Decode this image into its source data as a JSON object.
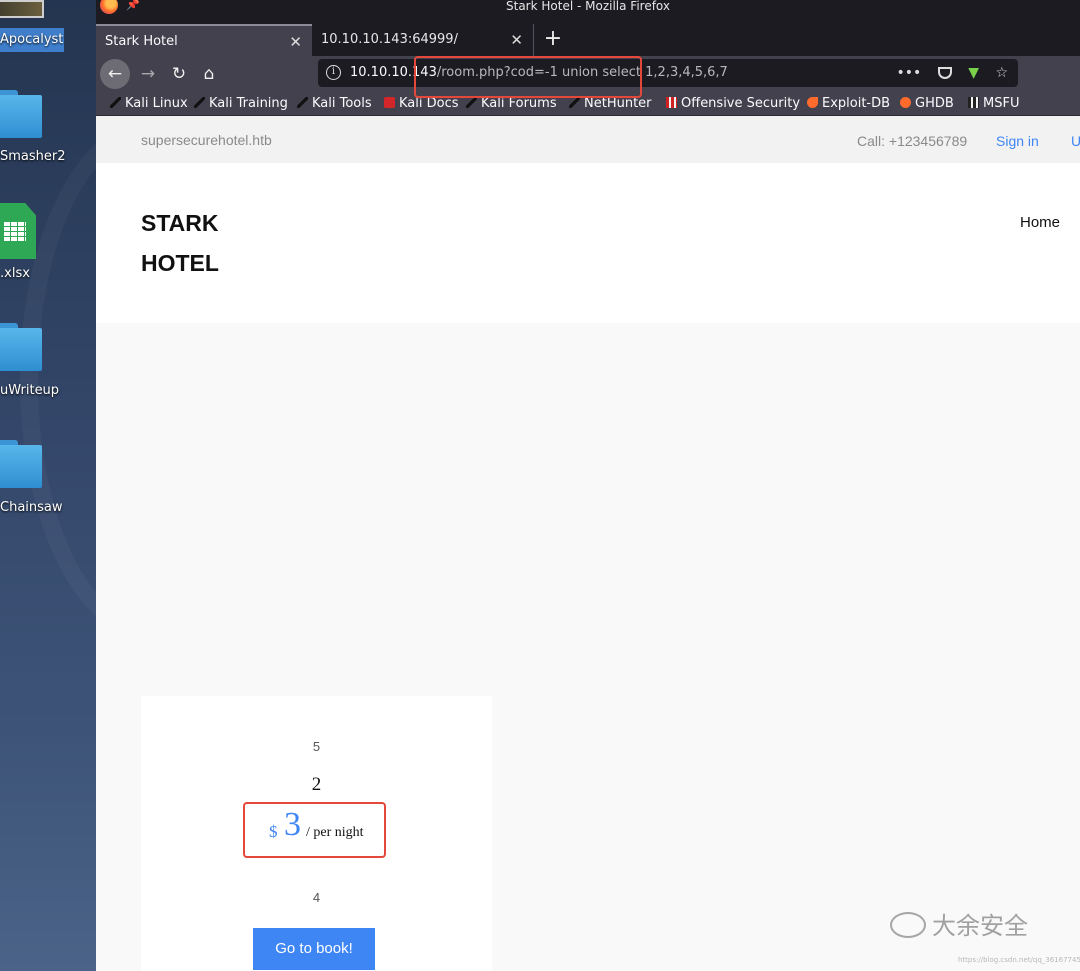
{
  "desktop": {
    "items": [
      {
        "label": "Apocalyst"
      },
      {
        "label": "Smasher2"
      },
      {
        "label": ".xlsx"
      },
      {
        "label": "uWriteup"
      },
      {
        "label": "Chainsaw"
      }
    ]
  },
  "window": {
    "title": "Stark Hotel - Mozilla Firefox"
  },
  "tabs": [
    {
      "label": "Stark Hotel",
      "active": true
    },
    {
      "label": "10.10.10.143:64999/",
      "active": false
    }
  ],
  "urlbar": {
    "host": "10.10.10.143",
    "rest": "/room.php?cod=-1 union select 1,2,3,4,5,6,7"
  },
  "bookmarks": [
    {
      "label": "Kali Linux"
    },
    {
      "label": "Kali Training"
    },
    {
      "label": "Kali Tools"
    },
    {
      "label": "Kali Docs"
    },
    {
      "label": "Kali Forums"
    },
    {
      "label": "NetHunter"
    },
    {
      "label": "Offensive Security"
    },
    {
      "label": "Exploit-DB"
    },
    {
      "label": "GHDB"
    },
    {
      "label": "MSFU"
    }
  ],
  "site": {
    "domain": "supersecurehotel.htb",
    "call": "Call: +123456789",
    "sign_in": "Sign in",
    "sign_up": "U",
    "brand_line1": "STARK",
    "brand_line2": "HOTEL",
    "nav_home": "Home"
  },
  "room": {
    "field5": "5",
    "field2": "2",
    "currency": "$",
    "price": "3",
    "per_night": "/ per night",
    "field4": "4",
    "book_label": "Go to book!"
  },
  "watermark": {
    "text": "大余安全",
    "sub": "https://blog.csdn.net/qq_36167745"
  }
}
